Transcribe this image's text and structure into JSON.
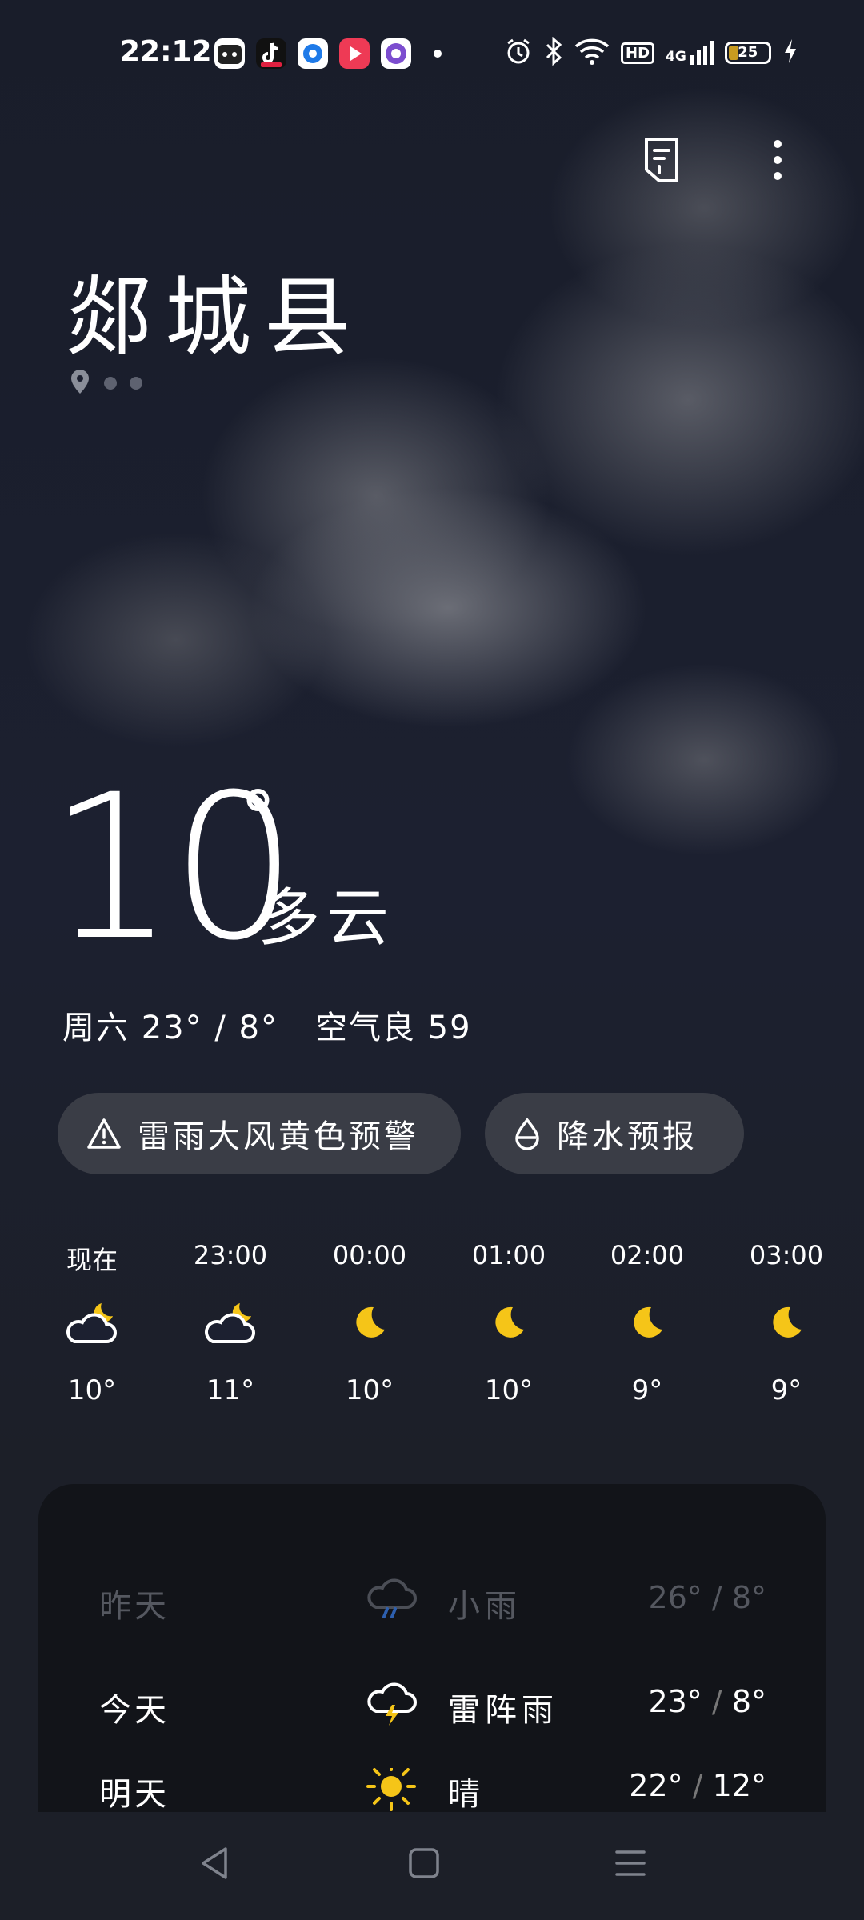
{
  "status_bar": {
    "time": "22:12",
    "apps": [
      "cat-app-icon",
      "tiktok-icon",
      "browser-app-icon",
      "video-app-icon",
      "purple-app-icon"
    ],
    "system": [
      "alarm-icon",
      "bluetooth-icon",
      "wifi-icon",
      "hd-icon",
      "signal-4g-icon",
      "battery-icon",
      "charging-icon"
    ],
    "hd": "HD",
    "network": "4G",
    "battery": "25"
  },
  "header": {
    "city": "郯城县"
  },
  "current": {
    "temp": "10",
    "degree": "°",
    "condition": "多云",
    "summary_temps": "周六 23° / 8°",
    "air_quality": "空气良 59"
  },
  "alerts": {
    "warning": "雷雨大风黄色预警",
    "precip": "降水预报"
  },
  "hourly": [
    {
      "time": "现在",
      "icon": "cloudy-night-icon",
      "temp": "10°"
    },
    {
      "time": "23:00",
      "icon": "cloudy-night-icon",
      "temp": "11°"
    },
    {
      "time": "00:00",
      "icon": "moon-icon",
      "temp": "10°"
    },
    {
      "time": "01:00",
      "icon": "moon-icon",
      "temp": "10°"
    },
    {
      "time": "02:00",
      "icon": "moon-icon",
      "temp": "9°"
    },
    {
      "time": "03:00",
      "icon": "moon-icon",
      "temp": "9°"
    }
  ],
  "daily": [
    {
      "day": "昨天",
      "icon": "rain-icon",
      "cond": "小雨",
      "high": "26°",
      "sep": "/",
      "low": "8°"
    },
    {
      "day": "今天",
      "icon": "thunderstorm-icon",
      "cond": "雷阵雨",
      "high": "23°",
      "sep": "/",
      "low": "8°"
    },
    {
      "day": "明天",
      "icon": "sun-icon",
      "cond": "晴",
      "high": "22°",
      "sep": "/",
      "low": "12°"
    }
  ],
  "colors": {
    "accent_yellow": "#f5c518",
    "pill_bg": "#3a3d46",
    "card_bg": "#121419"
  }
}
